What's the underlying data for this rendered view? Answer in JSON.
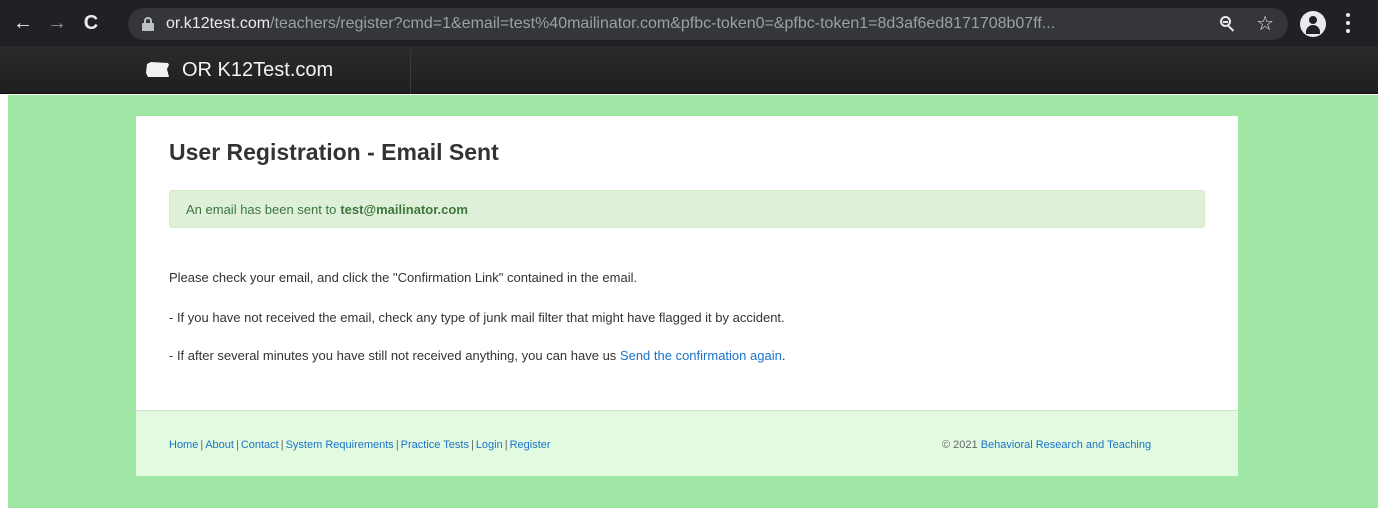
{
  "browser": {
    "url_host": "or.k12test.com",
    "url_path": "/teachers/register?cmd=1&email=test%40mailinator.com&pfbc-token0=&pfbc-token1=8d3af6ed8171708b07ff...",
    "back_icon": "←",
    "forward_icon": "→",
    "reload_icon": "C",
    "star_icon": "☆"
  },
  "site": {
    "brand": "OR K12Test.com"
  },
  "main": {
    "title": "User Registration - Email Sent",
    "alert_prefix": "An email has been sent to",
    "alert_email": "test@mailinator.com",
    "para1": "Please check your email, and click the \"Confirmation Link\" contained in the email.",
    "para2": "- If you have not received the email, check any type of junk mail filter that might have flagged it by accident.",
    "para3_prefix": "- If after several minutes you have still not received anything, you can have us",
    "para3_link": "Send the confirmation again",
    "para3_suffix": "."
  },
  "footer": {
    "links": [
      "Home",
      "About",
      "Contact",
      "System Requirements",
      "Practice Tests",
      "Login",
      "Register"
    ],
    "separator": "|",
    "copyright_prefix": "© 2021",
    "copyright_link": "Behavioral Research and Teaching"
  },
  "colors": {
    "page_bg": "#a0e6a4",
    "navbar_bg": "#222222",
    "alert_bg": "#dff0d8",
    "alert_text": "#3c763d",
    "link": "#1a73c8",
    "footer_bg": "#e2fbe0"
  }
}
